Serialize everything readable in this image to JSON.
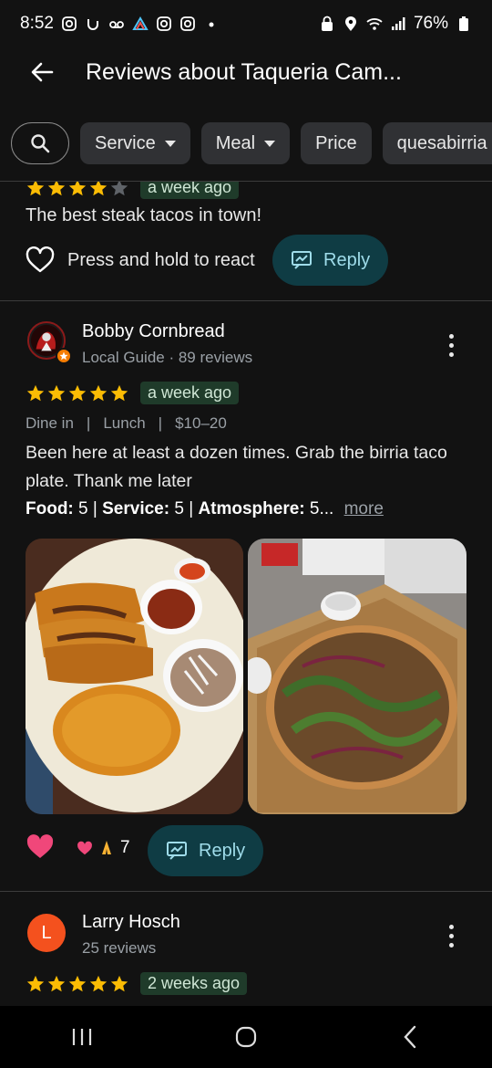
{
  "status": {
    "time": "8:52",
    "battery": "76%"
  },
  "header": {
    "title": "Reviews about Taqueria Cam..."
  },
  "chips": [
    {
      "label": "Service"
    },
    {
      "label": "Meal"
    },
    {
      "label": "Price"
    },
    {
      "label": "quesabirria"
    }
  ],
  "prev_review": {
    "stars": 4,
    "time": "a week ago",
    "text": "The best steak tacos in town!",
    "react_label": "Press and hold to react",
    "reply_label": "Reply"
  },
  "review1": {
    "name": "Bobby Cornbread",
    "meta": "Local Guide · 89 reviews",
    "stars": 5,
    "time": "a week ago",
    "tags": [
      "Dine in",
      "Lunch",
      "$10–20"
    ],
    "text": "Been here at least a dozen times. Grab the birria taco plate. Thank me later",
    "ratings": {
      "food_label": "Food:",
      "food_value": "5",
      "service_label": "Service:",
      "service_value": "5",
      "atmosphere_label": "Atmosphere:",
      "atmosphere_value": "5...",
      "more": "more"
    },
    "reaction_count": "7",
    "reply_label": "Reply"
  },
  "review2": {
    "initial": "L",
    "name": "Larry Hosch",
    "meta": "25 reviews",
    "stars": 5,
    "time": "2 weeks ago",
    "avatar_color": "#f4511e"
  },
  "colors": {
    "star": "#fbbc04",
    "reply_bg": "#0f3c44",
    "reply_text": "#9fdcea",
    "badge_bg": "#1f3b2a",
    "heart": "#f0477a"
  }
}
